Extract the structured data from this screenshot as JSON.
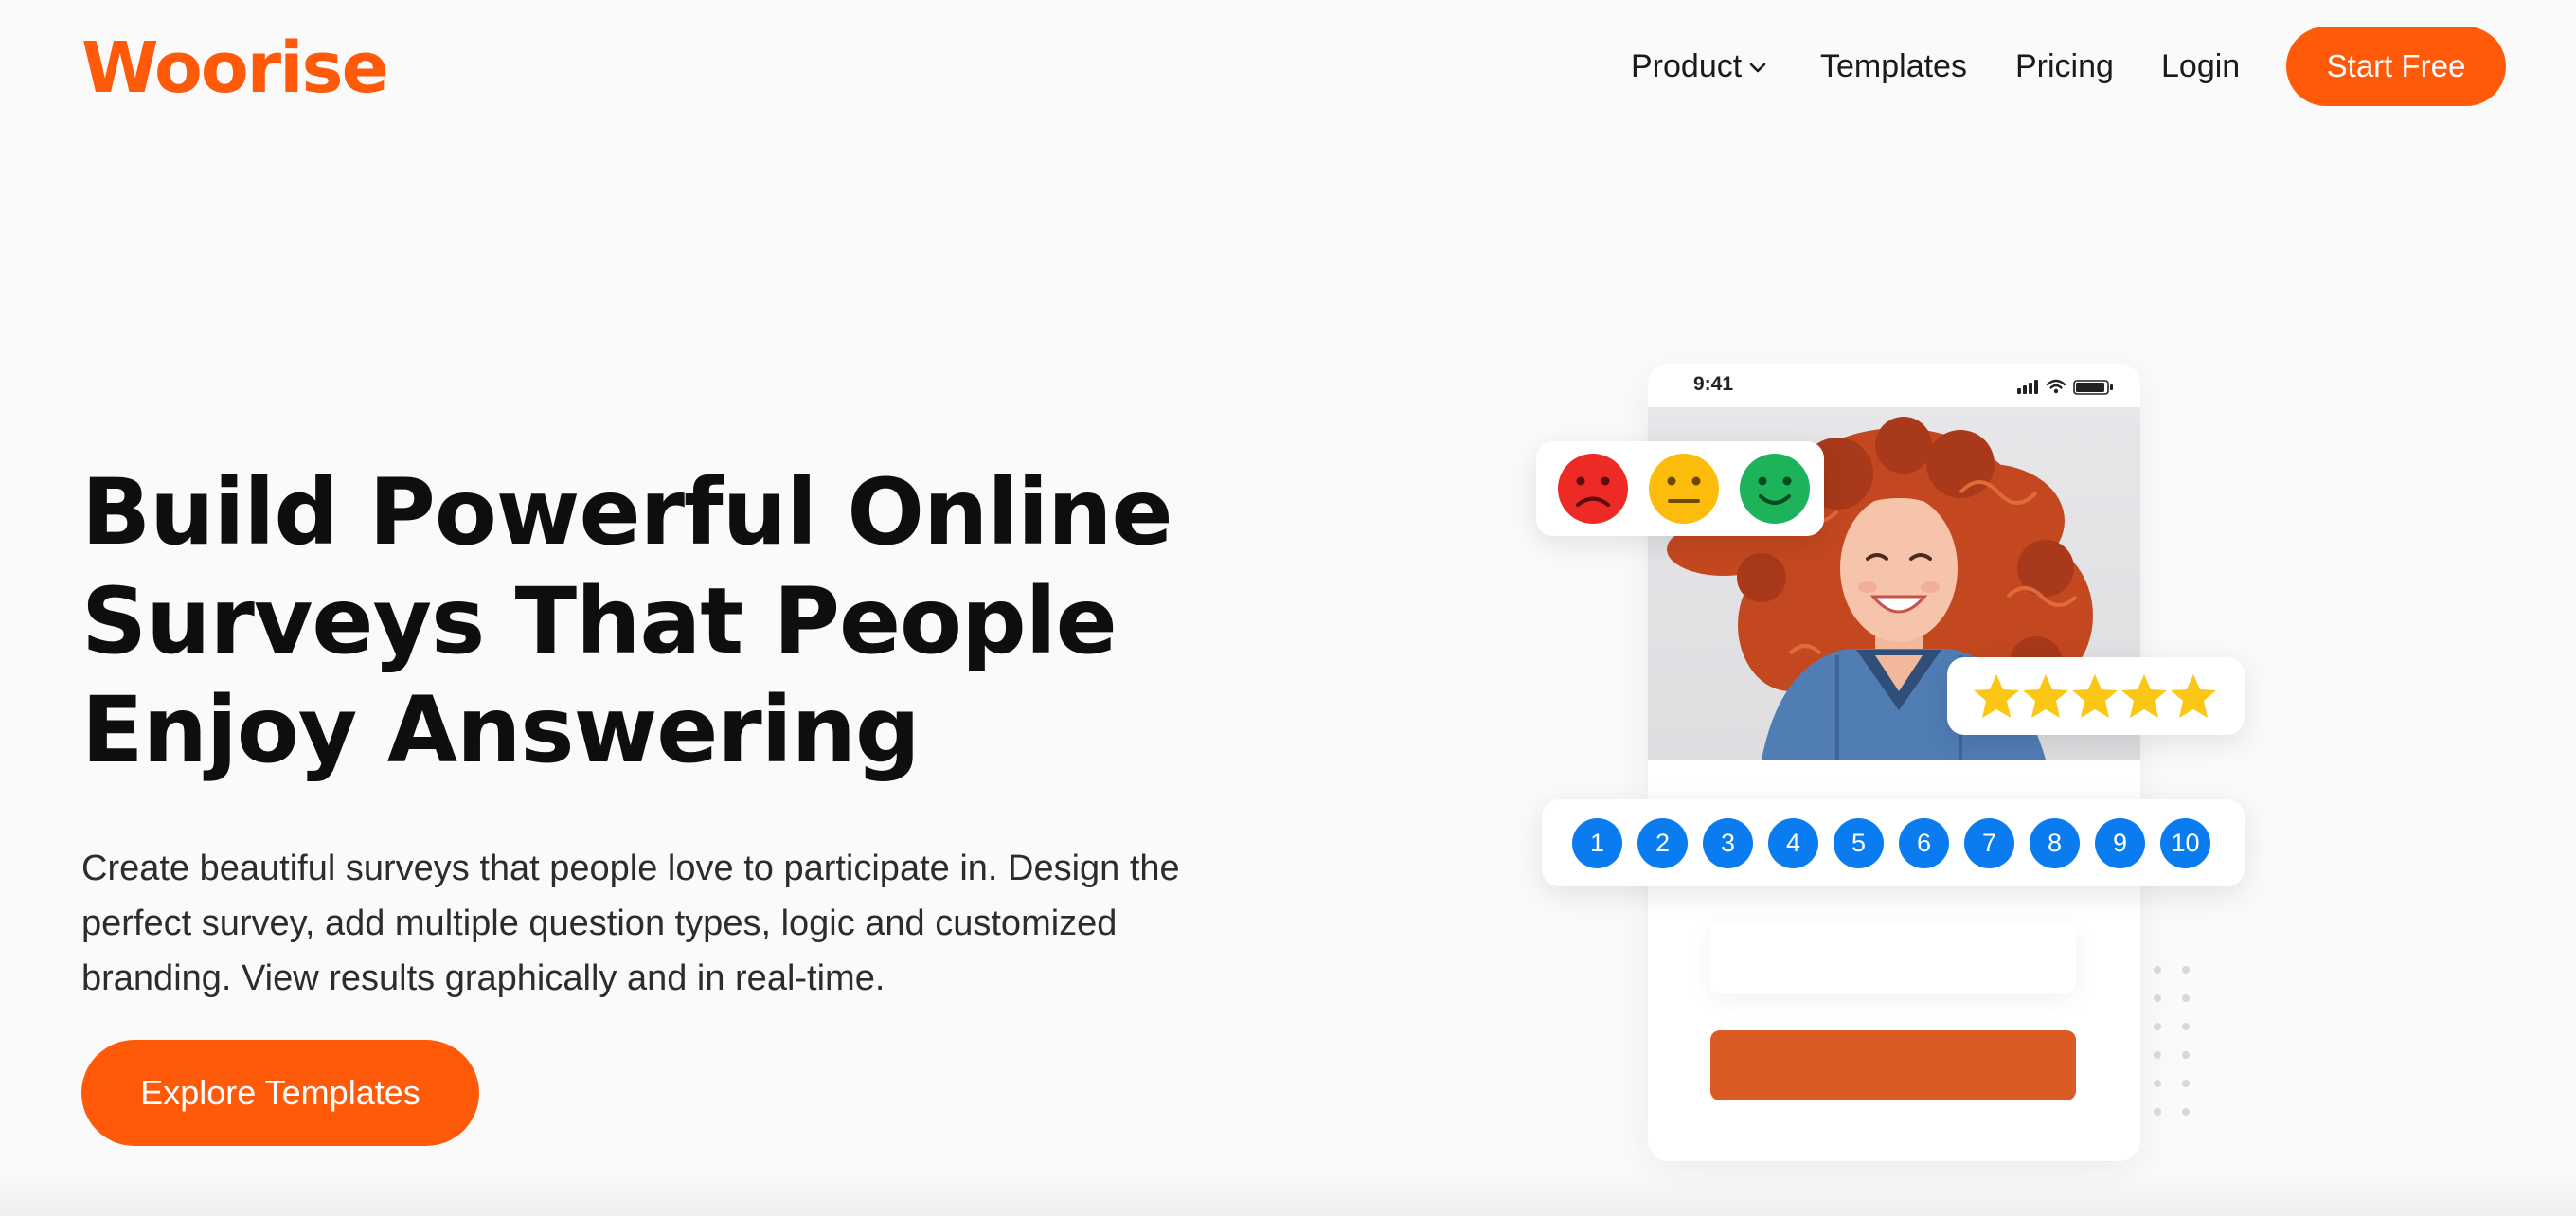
{
  "brand": {
    "logo_text": "Woorise",
    "accent_color": "#ff5a0a"
  },
  "nav": {
    "product": "Product",
    "templates": "Templates",
    "pricing": "Pricing",
    "login": "Login",
    "start_free": "Start Free"
  },
  "hero": {
    "title_lines": [
      "Build Powerful Online",
      "Surveys That People",
      "Enjoy Answering"
    ],
    "description_lines": [
      "Create beautiful surveys that people love to participate in. Design the",
      "perfect survey, add multiple question types, logic and customized",
      "branding. View results graphically and in real-time."
    ],
    "cta": "Explore Templates"
  },
  "illustration": {
    "status_time": "9:41",
    "emoji_faces": [
      "sad-face-icon",
      "neutral-face-icon",
      "happy-face-icon"
    ],
    "emoji_colors": [
      "#ee2a26",
      "#fbbc0c",
      "#1db35a"
    ],
    "star_rating": 5,
    "star_color": "#fbc614",
    "scale_numbers": [
      "1",
      "2",
      "3",
      "4",
      "5",
      "6",
      "7",
      "8",
      "9",
      "10"
    ],
    "scale_color": "#0a7cf0"
  }
}
